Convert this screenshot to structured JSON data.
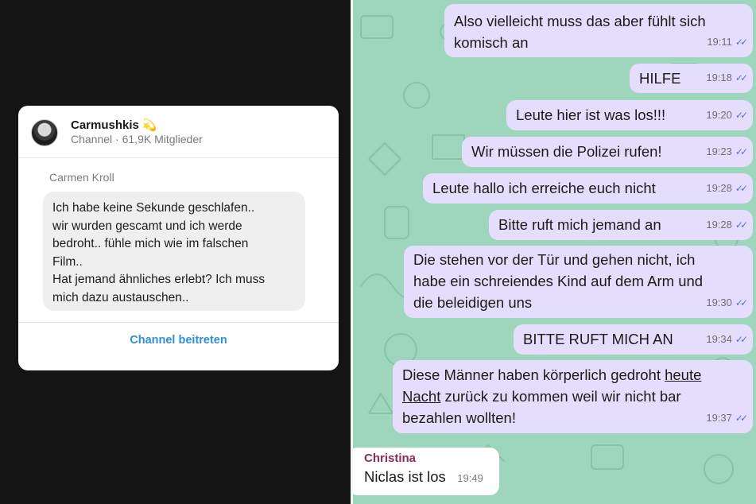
{
  "channel_card": {
    "channel_name": "Carmushkis",
    "name_emoji": "💫",
    "channel_type": "Channel",
    "separator": "·",
    "members": "61,9K Mitglieder",
    "sender": "Carmen Kroll",
    "message": "Ich habe keine Sekunde geschlafen..\nwir wurden gescamt und ich werde\nbedroht.. fühle mich wie im falschen\nFilm..\nHat jemand ähnliches erlebt? Ich muss\nmich dazu austauschen..",
    "join_label": "Channel beitreten"
  },
  "chat": {
    "ticks_icon": "double-check-icon",
    "accent_color": "#5b6fd8",
    "outgoing_bubble_color": "#e6dcfb",
    "wallpaper_color": "#9ed6bd",
    "messages": [
      {
        "text": "Also vielleicht muss das aber fühlt sich\nkomisch an",
        "time": "19:11"
      },
      {
        "text": "HILFE",
        "time": "19:18"
      },
      {
        "text": "Leute hier ist was los!!!",
        "time": "19:20"
      },
      {
        "text": "Wir müssen die Polizei rufen!",
        "time": "19:23"
      },
      {
        "text": "Leute hallo ich erreiche euch nicht",
        "time": "19:28"
      },
      {
        "text": "Bitte ruft mich jemand an",
        "time": "19:28"
      },
      {
        "text": "Die stehen vor der Tür und gehen nicht, ich\nhabe ein schreiendes Kind auf dem Arm und\ndie beleidigen uns",
        "time": "19:30"
      },
      {
        "text": "BITTE RUFT MICH AN",
        "time": "19:34"
      },
      {
        "text_before": "Diese Männer haben körperlich gedroht ",
        "text_underlined_1": "heute",
        "text_newline": "\n",
        "text_underlined_2": "Nacht",
        "text_after": " zurück zu kommen weil wir nicht bar\nbezahlen wollten!",
        "time": "19:37"
      }
    ],
    "incoming": {
      "author": "Christina",
      "text": "Niclas ist los",
      "time": "19:49"
    }
  }
}
